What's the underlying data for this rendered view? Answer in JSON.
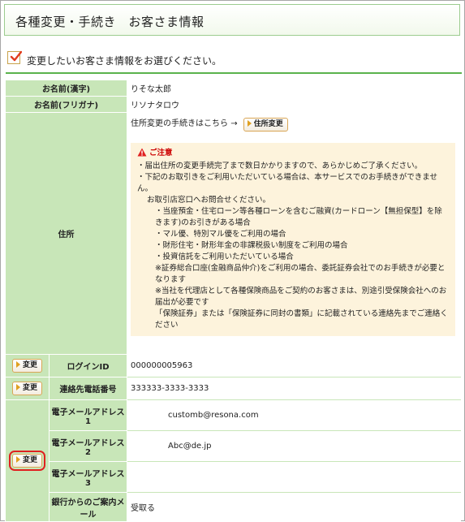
{
  "page_title": "各種変更・手続き　お客さま情報",
  "section_heading": "変更したいお客さま情報をお選びください。",
  "rows": {
    "name_kanji": {
      "label": "お名前(漢字)",
      "value": "りそな太郎"
    },
    "name_kana": {
      "label": "お名前(フリガナ)",
      "value": "リソナタロウ"
    },
    "address": {
      "label": "住所",
      "intro": "住所変更の手続きはこちら →",
      "button": "住所変更",
      "notice_title": "ご注意",
      "notice_lines": [
        "・届出住所の変更手続完了まで数日かかりますので、あらかじめご了承ください。",
        "・下記のお取引きをご利用いただいている場合は、本サービスでのお手続きができません。",
        "お取引店窓口へお問合せください。",
        "・当座預金・住宅ローン等各種ローンを含むご融資(カードローン【無担保型】を除きます)のお引きがある場合",
        "・マル優、特別マル優をご利用の場合",
        "・財形住宅・財形年金の非課税扱い制度をご利用の場合",
        "・投資信託をご利用いただいている場合",
        "※証券総合口座(金融商品仲介)をご利用の場合、委託証券会社でのお手続きが必要となります",
        "※当社を代理店として各種保険商品をご契約のお客さまは、別途引受保険会社へのお届出が必要です",
        "「保険証券」または「保険証券に同封の書類」に記載されている連絡先までご連絡ください"
      ]
    },
    "login_id": {
      "label": "ログインID",
      "value": "000000005963",
      "button": "変更"
    },
    "phone": {
      "label": "連絡先電話番号",
      "value": "333333-3333-3333",
      "button": "変更"
    },
    "email": {
      "button": "変更",
      "items": [
        {
          "label": "電子メールアドレス1",
          "value": "customb@resona.com"
        },
        {
          "label": "電子メールアドレス2",
          "value": "Abc@de.jp"
        },
        {
          "label": "電子メールアドレス3",
          "value": ""
        }
      ],
      "bank_info_label": "銀行からのご案内メール",
      "bank_info_value": "受取る"
    }
  },
  "colors": {
    "label_bg": "#c8e6b8",
    "accent_green": "#5ab34c",
    "notice_bg": "#fdf3dc",
    "highlight_red": "#e02020"
  }
}
